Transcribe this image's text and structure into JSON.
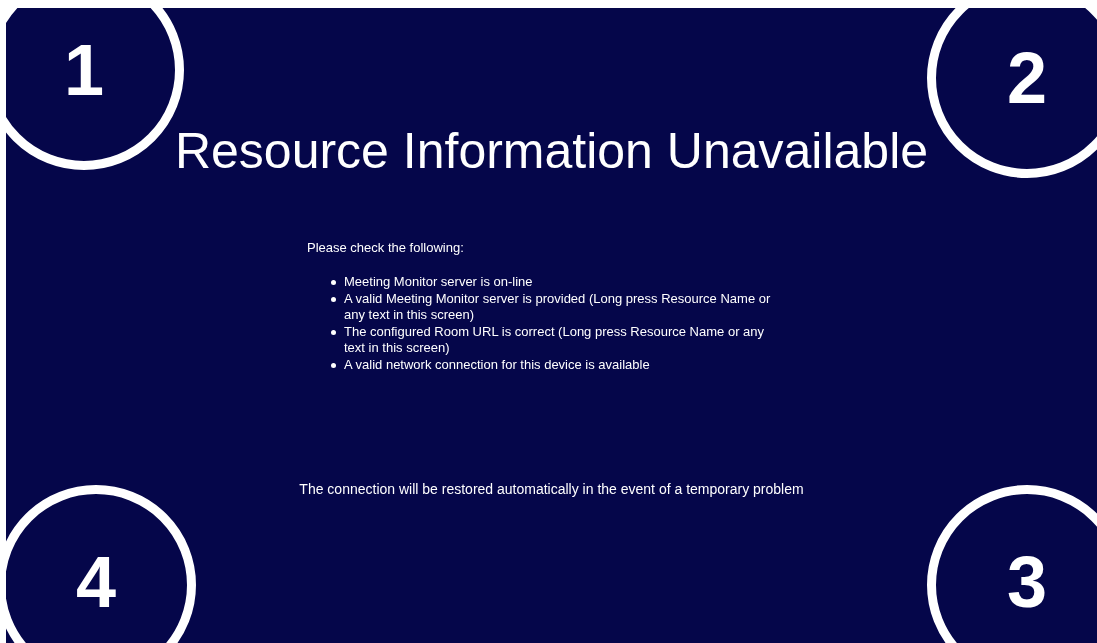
{
  "title": "Resource Information Unavailable",
  "intro": "Please check the following:",
  "checklist": [
    "Meeting Monitor server is on-line",
    "A valid Meeting Monitor server is provided (Long press Resource Name or any text in this screen)",
    "The configured Room URL is correct (Long press Resource Name or any text in this screen)",
    "A valid network connection for this device is available"
  ],
  "footer": "The connection will be restored automatically in the event of a temporary problem",
  "corner_markers": [
    "1",
    "2",
    "4",
    "3"
  ]
}
